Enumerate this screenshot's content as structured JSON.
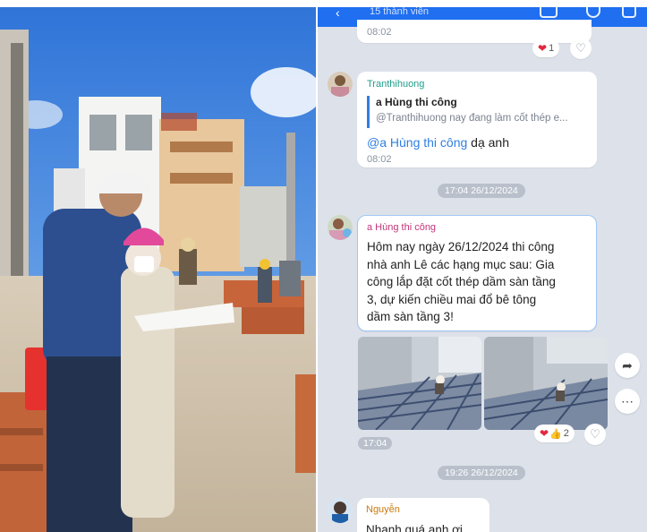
{
  "chat": {
    "header_subtitle": "15 thành viên",
    "messages": [
      {
        "time": "08:02",
        "reaction_count": "1"
      },
      {
        "sender": "Tranthihuong",
        "quote_author": "a Hùng thi công",
        "quote_text": "@Tranthihuong nay đang làm cốt thép e...",
        "mention": "@a Hùng thi công",
        "text": " dạ anh",
        "time": "08:02"
      },
      {
        "separator": "17:04 26/12/2024",
        "sender": "a Hùng thi công",
        "text_lines": [
          "Hôm nay ngày 26/12/2024 thi công",
          "nhà anh Lê các hạng mục sau: Gia",
          "công lắp đặt cốt thép dầm sàn tầng",
          "3, dự kiến chiều mai đổ bê tông",
          "dầm sàn tầng 3!"
        ],
        "time": "17:04",
        "reaction_count": "2"
      },
      {
        "separator": "19:26 26/12/2024",
        "sender": "Nguyễn",
        "text": "Nhanh quá anh ơi"
      }
    ]
  },
  "colors": {
    "accent": "#1f6ff0",
    "chat_bg": "#dde2ea",
    "mention": "#2f7fe0",
    "sender_green": "#1f9e8a",
    "sender_pink": "#c2357b",
    "sender_orange": "#c8790f",
    "heart": "#e3263d"
  },
  "icons": [
    "back-arrow-icon",
    "call-icon",
    "search-icon",
    "menu-icon",
    "heart-icon",
    "thumbs-up-icon",
    "share-forward-icon",
    "more-icon"
  ]
}
